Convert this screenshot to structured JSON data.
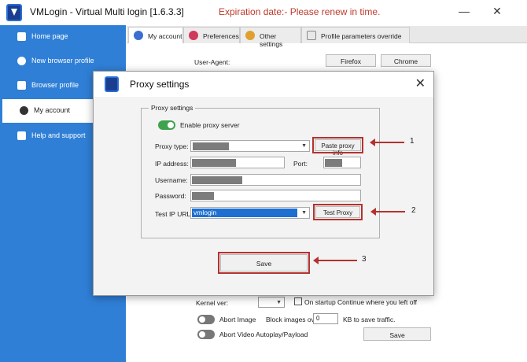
{
  "app": {
    "title": "VMLogin - Virtual Multi login [1.6.3.3]",
    "expiry": "Expiration date:-  Please renew in time."
  },
  "window_controls": {
    "minimize": "—",
    "close": "✕"
  },
  "sidebar": {
    "items": [
      {
        "label": "Home page",
        "icon": "home-icon"
      },
      {
        "label": "New browser profile",
        "icon": "plus-icon"
      },
      {
        "label": "Browser profile",
        "icon": "folder-icon"
      },
      {
        "label": "My account",
        "icon": "user-icon",
        "active": true
      },
      {
        "label": "Help and support",
        "icon": "help-icon"
      }
    ]
  },
  "tabs": [
    {
      "label": "My account",
      "active": true
    },
    {
      "label": "Preferences"
    },
    {
      "label": "Other settings"
    },
    {
      "label": "Profile parameters override"
    }
  ],
  "bg_form": {
    "user_agent_label": "User-Agent:",
    "firefox_btn": "Firefox",
    "chrome_btn": "Chrome",
    "kernel_label": "Kernel ver:",
    "startup_label": "On startup Continue where you left off",
    "abort_image_label": "Abort Image",
    "block_images_label": "Block images over",
    "kb_label": "KB to save traffic.",
    "block_value": "0",
    "abort_video_label": "Abort Video Autoplay/Payload",
    "save_btn": "Save"
  },
  "dialog": {
    "title": "Proxy settings",
    "group_title": "Proxy settings",
    "enable_label": "Enable proxy server",
    "proxy_type_label": "Proxy type:",
    "paste_btn": "Paste proxy info",
    "ip_label": "IP address:",
    "port_label": "Port:",
    "username_label": "Username:",
    "password_label": "Password:",
    "test_url_label": "Test IP URL:",
    "test_url_value": "vmlogin",
    "test_btn": "Test Proxy",
    "save_btn": "Save"
  },
  "annotations": [
    "1",
    "2",
    "3"
  ],
  "colors": {
    "sidebar": "#2f7fd6",
    "accent_red": "#b4322e",
    "toggle_on": "#3fa34d",
    "selected": "#1e6fd0"
  }
}
